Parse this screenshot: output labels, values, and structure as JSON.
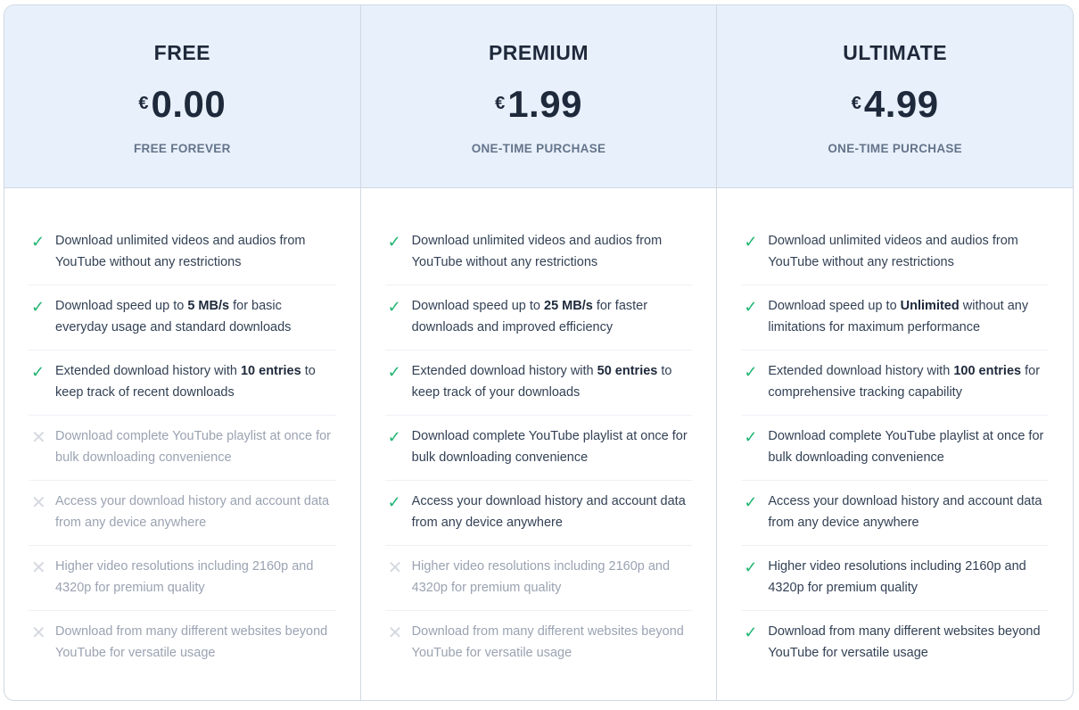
{
  "plans": [
    {
      "name": "FREE",
      "currency": "€",
      "price": "0.00",
      "subtitle": "FREE FOREVER",
      "features": [
        {
          "included": true,
          "pre": "Download unlimited videos and audios from YouTube without any restrictions",
          "bold": "",
          "post": ""
        },
        {
          "included": true,
          "pre": "Download speed up to ",
          "bold": "5 MB/s",
          "post": " for basic everyday usage and standard downloads"
        },
        {
          "included": true,
          "pre": "Extended download history with ",
          "bold": "10 entries",
          "post": " to keep track of recent downloads"
        },
        {
          "included": false,
          "pre": "Download complete YouTube playlist at once for bulk downloading convenience",
          "bold": "",
          "post": ""
        },
        {
          "included": false,
          "pre": "Access your download history and account data from any device anywhere",
          "bold": "",
          "post": ""
        },
        {
          "included": false,
          "pre": "Higher video resolutions including 2160p and 4320p for premium quality",
          "bold": "",
          "post": ""
        },
        {
          "included": false,
          "pre": "Download from many different websites beyond YouTube for versatile usage",
          "bold": "",
          "post": ""
        }
      ]
    },
    {
      "name": "PREMIUM",
      "currency": "€",
      "price": "1.99",
      "subtitle": "ONE-TIME PURCHASE",
      "features": [
        {
          "included": true,
          "pre": "Download unlimited videos and audios from YouTube without any restrictions",
          "bold": "",
          "post": ""
        },
        {
          "included": true,
          "pre": "Download speed up to ",
          "bold": "25 MB/s",
          "post": " for faster downloads and improved efficiency"
        },
        {
          "included": true,
          "pre": "Extended download history with ",
          "bold": "50 entries",
          "post": " to keep track of your downloads"
        },
        {
          "included": true,
          "pre": "Download complete YouTube playlist at once for bulk downloading convenience",
          "bold": "",
          "post": ""
        },
        {
          "included": true,
          "pre": "Access your download history and account data from any device anywhere",
          "bold": "",
          "post": ""
        },
        {
          "included": false,
          "pre": "Higher video resolutions including 2160p and 4320p for premium quality",
          "bold": "",
          "post": ""
        },
        {
          "included": false,
          "pre": "Download from many different websites beyond YouTube for versatile usage",
          "bold": "",
          "post": ""
        }
      ]
    },
    {
      "name": "ULTIMATE",
      "currency": "€",
      "price": "4.99",
      "subtitle": "ONE-TIME PURCHASE",
      "features": [
        {
          "included": true,
          "pre": "Download unlimited videos and audios from YouTube without any restrictions",
          "bold": "",
          "post": ""
        },
        {
          "included": true,
          "pre": "Download speed up to ",
          "bold": "Unlimited",
          "post": " without any limitations for maximum performance"
        },
        {
          "included": true,
          "pre": "Extended download history with ",
          "bold": "100 entries",
          "post": " for comprehensive tracking capability"
        },
        {
          "included": true,
          "pre": "Download complete YouTube playlist at once for bulk downloading convenience",
          "bold": "",
          "post": ""
        },
        {
          "included": true,
          "pre": "Access your download history and account data from any device anywhere",
          "bold": "",
          "post": ""
        },
        {
          "included": true,
          "pre": "Higher video resolutions including 2160p and 4320p for premium quality",
          "bold": "",
          "post": ""
        },
        {
          "included": true,
          "pre": "Download from many different websites beyond YouTube for versatile usage",
          "bold": "",
          "post": ""
        }
      ]
    }
  ],
  "icons": {
    "yes": "✓",
    "no": "✕"
  },
  "colors": {
    "check": "#22b573",
    "header_bg": "#e8f0fb"
  }
}
